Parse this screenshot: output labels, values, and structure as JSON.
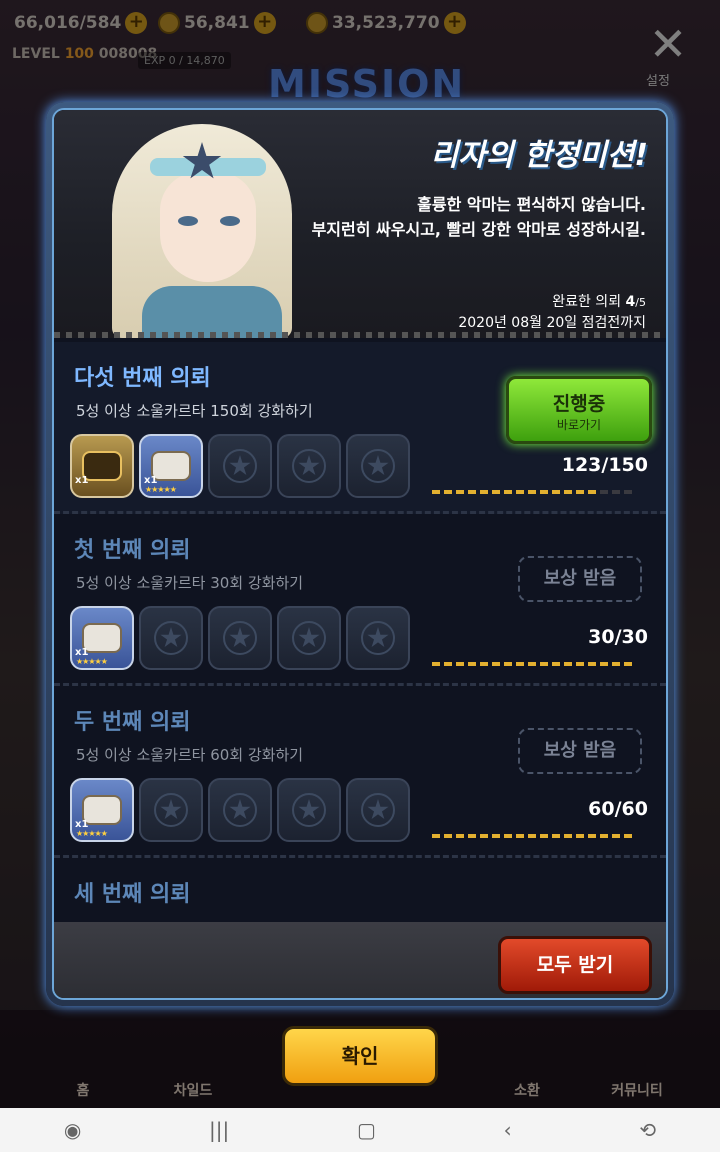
{
  "hud": {
    "stamina": "66,016/584",
    "gems": "56,841",
    "gold": "33,523,770",
    "level_label": "LEVEL",
    "level_value": "100",
    "player_id": "008008",
    "exp": "EXP 0 / 14,870",
    "settings_label": "설정",
    "mission_logo": "MISSION"
  },
  "banner": {
    "title": "리자의 한정미션!",
    "desc_line1": "훌륭한 악마는 편식하지 않습니다.",
    "desc_line2": "부지런히 싸우시고, 빨리 강한 악마로 성장하시길.",
    "progress_label": "완료한 의뢰",
    "progress_done": "4",
    "progress_total": "/5",
    "deadline": "2020년 08월 20일 점검전까지"
  },
  "tasks": [
    {
      "title": "다섯 번째 의뢰",
      "desc": "5성 이상 소울카르타 150회 강화하기",
      "count": "123/150",
      "progress": 0.82,
      "button_l1": "진행중",
      "button_l2": "바로가기",
      "reward1_qty": "x1",
      "reward2_qty": "x1",
      "reward2_stars": "★★★★★"
    },
    {
      "title": "첫 번째 의뢰",
      "desc": "5성 이상 소울카르타 30회 강화하기",
      "count": "30/30",
      "progress": 1.0,
      "button": "보상 받음",
      "reward_qty": "x1",
      "reward_stars": "★★★★★"
    },
    {
      "title": "두 번째 의뢰",
      "desc": "5성 이상 소울카르타 60회 강화하기",
      "count": "60/60",
      "progress": 1.0,
      "button": "보상 받음",
      "reward_qty": "x1",
      "reward_stars": "★★★★★"
    },
    {
      "title": "세 번째 의뢰"
    }
  ],
  "footer": {
    "receive_all": "모두 받기"
  },
  "confirm": "확인",
  "nav": {
    "home": "홈",
    "child": "차일드",
    "summon": "소환",
    "community": "커뮤니티"
  }
}
